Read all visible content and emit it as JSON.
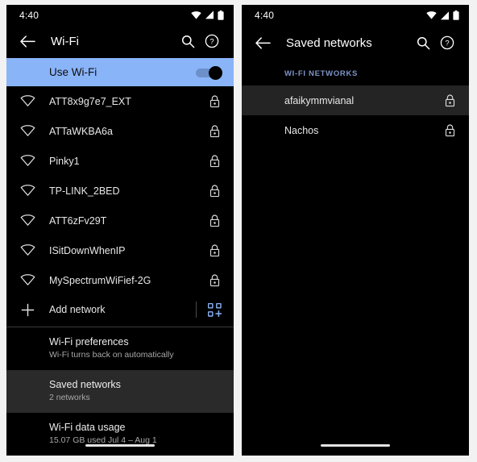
{
  "left_panel": {
    "status_bar": {
      "time": "4:40",
      "icons": [
        "wifi-icon",
        "signal-icon",
        "battery-icon"
      ]
    },
    "app_bar": {
      "back_label": "←",
      "title": "Wi-Fi",
      "search_label": "search-icon",
      "help_label": "help-icon"
    },
    "toggle": {
      "label": "Use Wi-Fi",
      "state": "on"
    },
    "networks": [
      {
        "name": "ATT8x9g7e7_EXT",
        "secured": true
      },
      {
        "name": "ATTaWKBA6a",
        "secured": true
      },
      {
        "name": "Pinky1",
        "secured": true
      },
      {
        "name": "TP-LINK_2BED",
        "secured": true
      },
      {
        "name": "ATT6zFv29T",
        "secured": true
      },
      {
        "name": "ISitDownWhenIP",
        "secured": true
      },
      {
        "name": "MySpectrumWiFief-2G",
        "secured": true
      }
    ],
    "add_network": {
      "label": "Add network",
      "qr_label": "qr-scan-icon"
    },
    "preferences": [
      {
        "title": "Wi-Fi preferences",
        "subtitle": "Wi-Fi turns back on automatically",
        "selected": false
      },
      {
        "title": "Saved networks",
        "subtitle": "2 networks",
        "selected": true
      },
      {
        "title": "Wi-Fi data usage",
        "subtitle": "15.07 GB used Jul 4 – Aug 1",
        "selected": false
      }
    ]
  },
  "right_panel": {
    "status_bar": {
      "time": "4:40",
      "icons": [
        "wifi-icon",
        "signal-icon",
        "battery-icon"
      ]
    },
    "app_bar": {
      "back_label": "←",
      "title": "Saved networks",
      "search_label": "search-icon",
      "help_label": "help-icon"
    },
    "section_header": "WI-FI NETWORKS",
    "saved_networks": [
      {
        "name": "afaikymmvianal",
        "secured": true,
        "selected": true
      },
      {
        "name": "Nachos",
        "secured": true,
        "selected": false
      }
    ]
  },
  "colors": {
    "background": "#000000",
    "accent_blue": "#8ab4f8",
    "section_header": "#7d95c9",
    "selected_row": "#2a2a2a",
    "text_primary": "#e8e8e8",
    "text_secondary": "#a8a8a8"
  }
}
